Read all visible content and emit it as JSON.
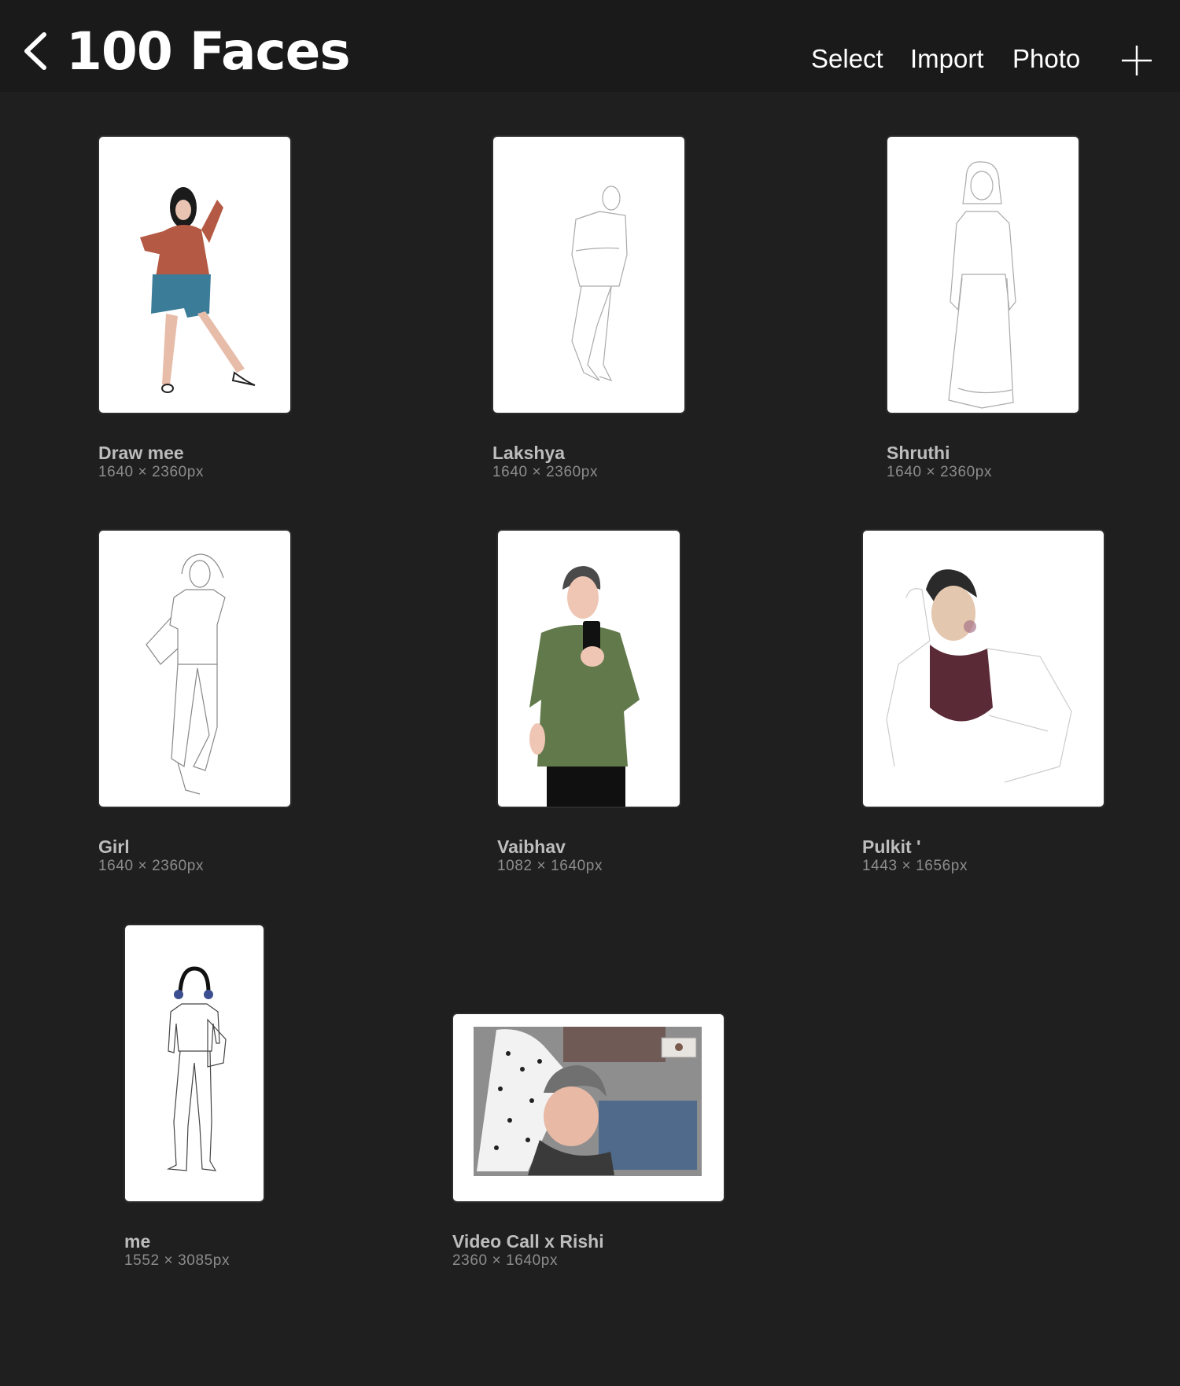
{
  "header": {
    "title": "100 Faces",
    "actions": {
      "select": "Select",
      "import": "Import",
      "photo": "Photo"
    },
    "icons": {
      "back": "chevron-left-icon",
      "add": "plus-icon"
    }
  },
  "artworks": [
    {
      "name": "Draw mee",
      "size": "1640 × 2360px"
    },
    {
      "name": "Lakshya",
      "size": "1640 × 2360px"
    },
    {
      "name": "Shruthi",
      "size": "1640 × 2360px"
    },
    {
      "name": "Girl",
      "size": "1640 × 2360px"
    },
    {
      "name": "Vaibhav",
      "size": "1082 × 1640px"
    },
    {
      "name": "Pulkit '",
      "size": "1443 × 1656px"
    },
    {
      "name": "me",
      "size": "1552 × 3085px"
    },
    {
      "name": "Video Call x Rishi",
      "size": "2360 × 1640px"
    }
  ],
  "colors": {
    "background": "#1f1f1f",
    "topbar": "#1a1a1a",
    "name_text": "#bdbdbd",
    "size_text": "#8c8c8c"
  }
}
